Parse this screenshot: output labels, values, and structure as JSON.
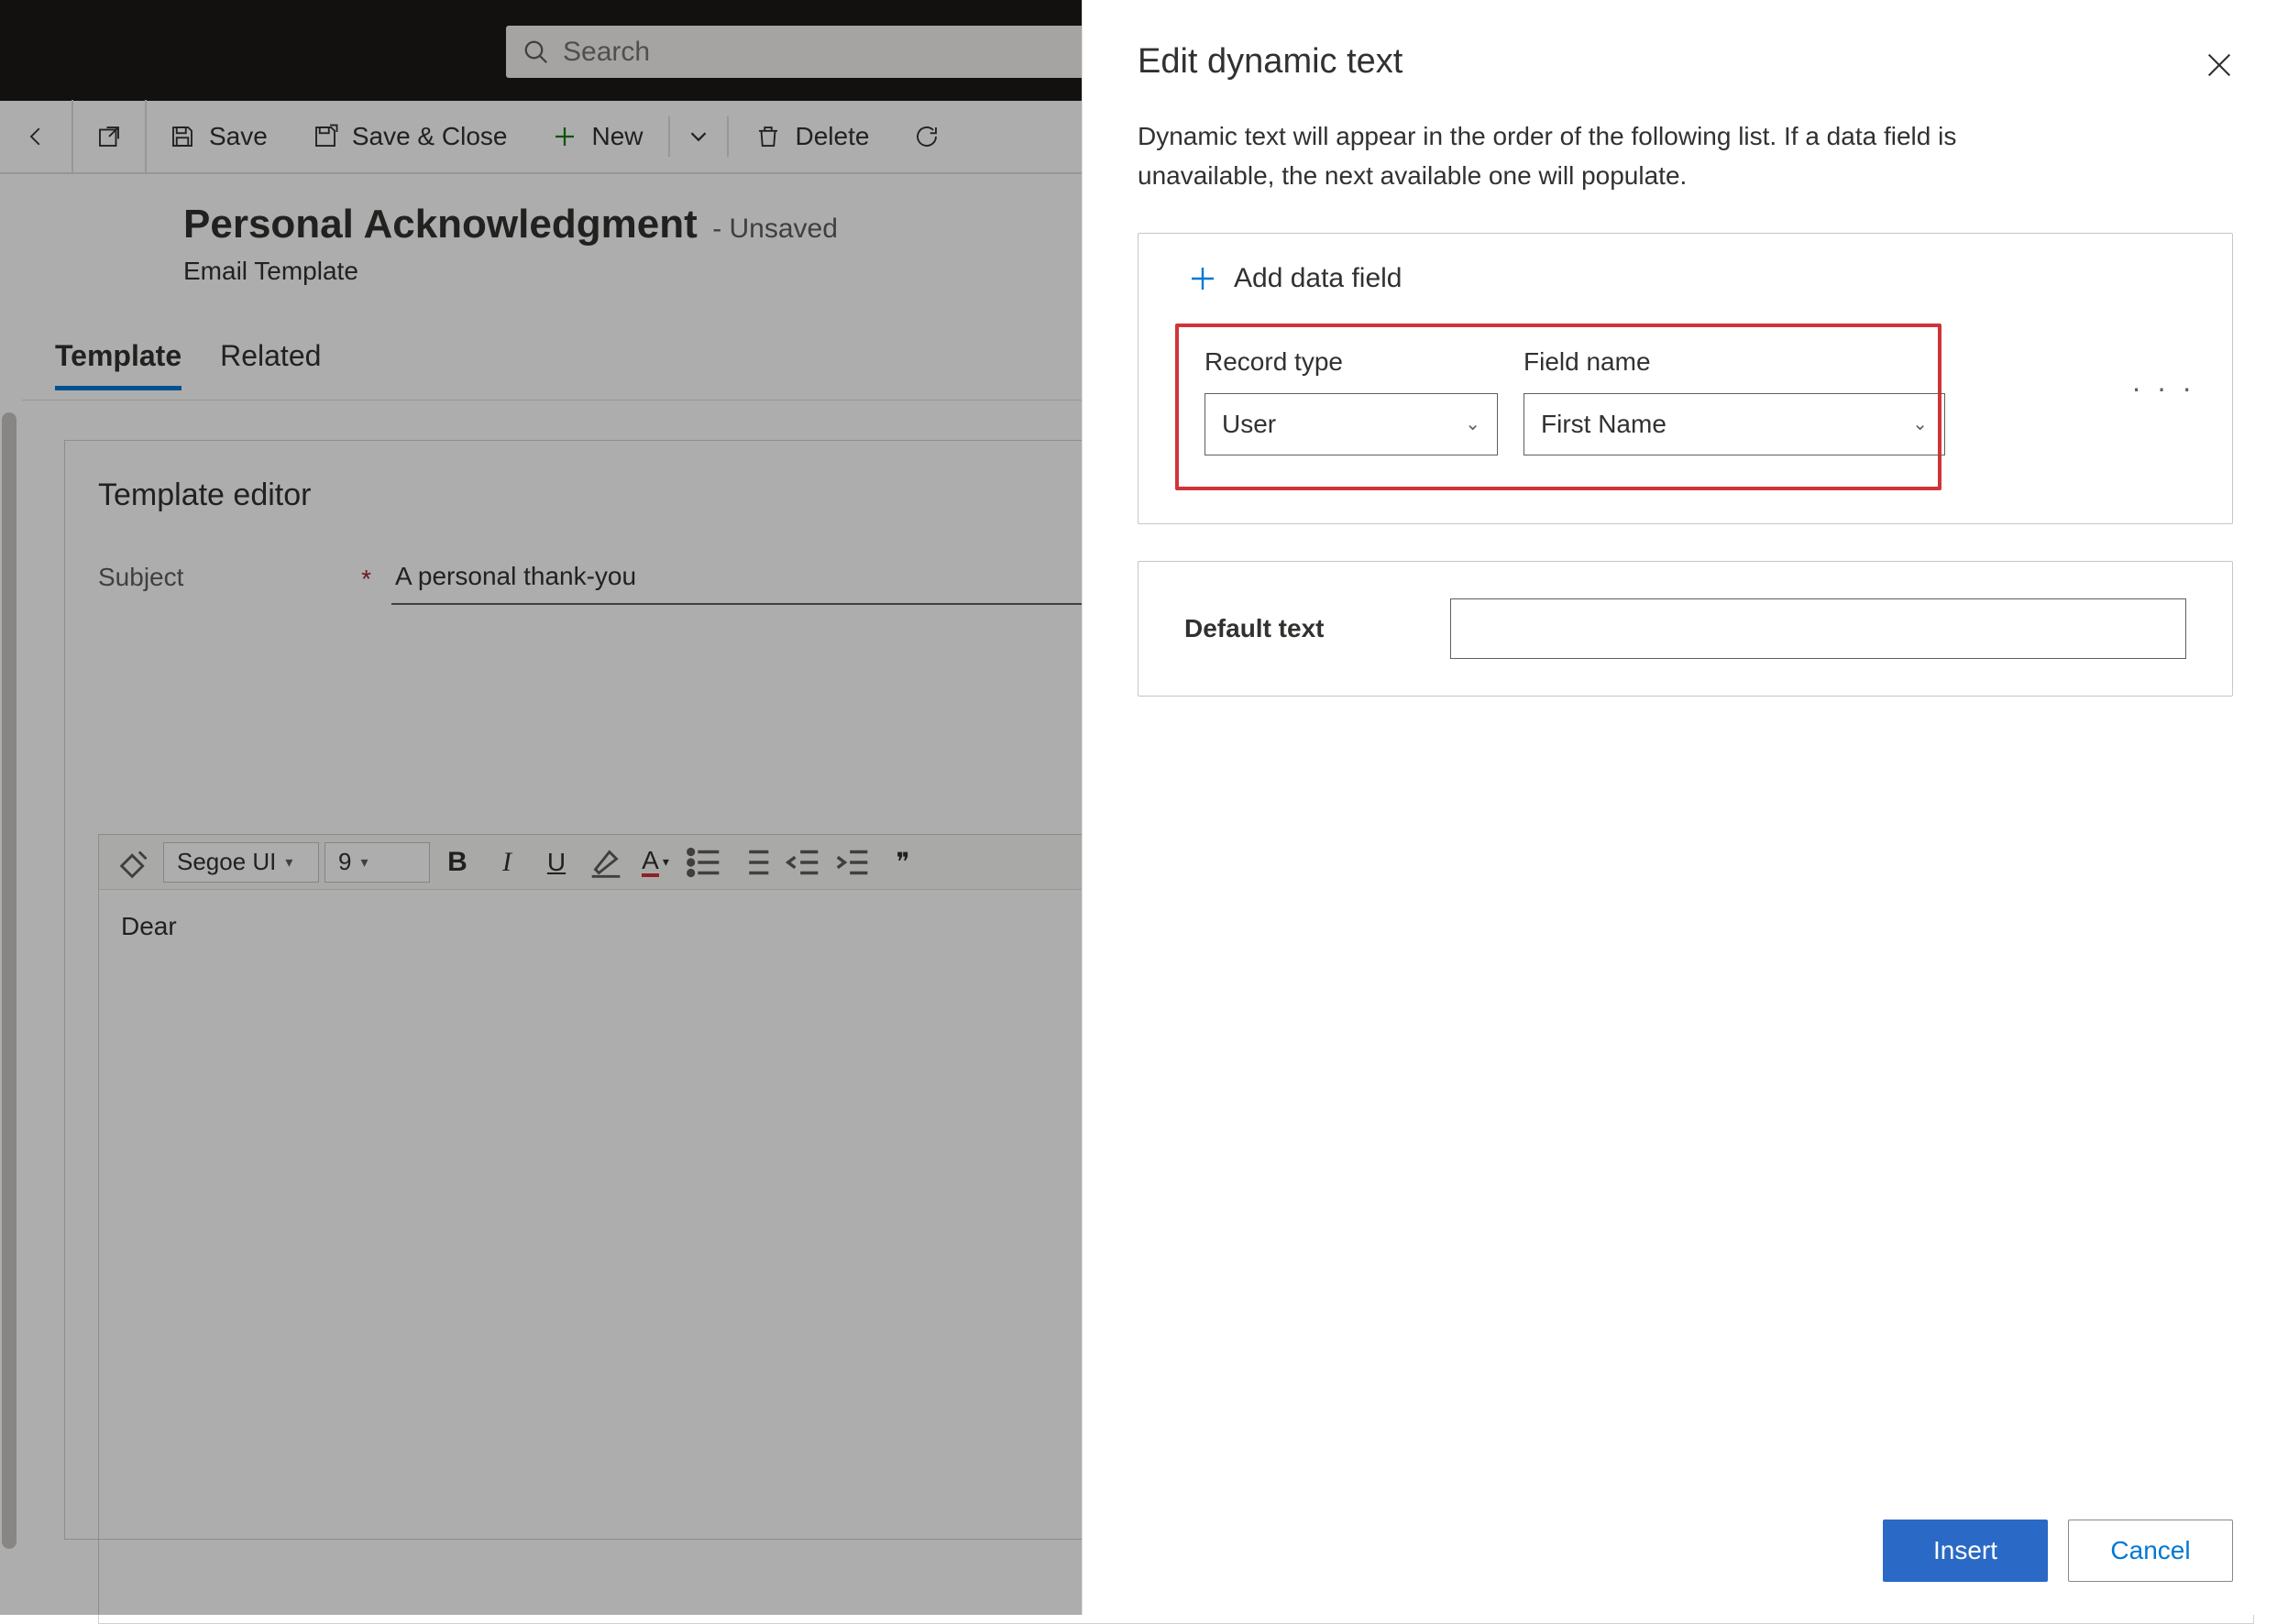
{
  "topbar": {
    "search_placeholder": "Search"
  },
  "commands": {
    "save": "Save",
    "save_close": "Save & Close",
    "new": "New",
    "delete": "Delete"
  },
  "record": {
    "title": "Personal Acknowledgment",
    "status": "- Unsaved",
    "subtitle": "Email Template"
  },
  "tabs": {
    "template": "Template",
    "related": "Related"
  },
  "editor": {
    "heading": "Template editor",
    "subject_label": "Subject",
    "subject_value": "A personal thank-you",
    "font_name": "Segoe UI",
    "font_size": "9",
    "body": "Dear"
  },
  "panel": {
    "title": "Edit dynamic text",
    "description": "Dynamic text will appear in the order of the following list. If a data field is unavailable, the next available one will populate.",
    "add_field": "Add data field",
    "record_type_label": "Record type",
    "field_name_label": "Field name",
    "record_type_value": "User",
    "field_name_value": "First Name",
    "default_text_label": "Default text",
    "default_text_value": "",
    "insert": "Insert",
    "cancel": "Cancel"
  }
}
